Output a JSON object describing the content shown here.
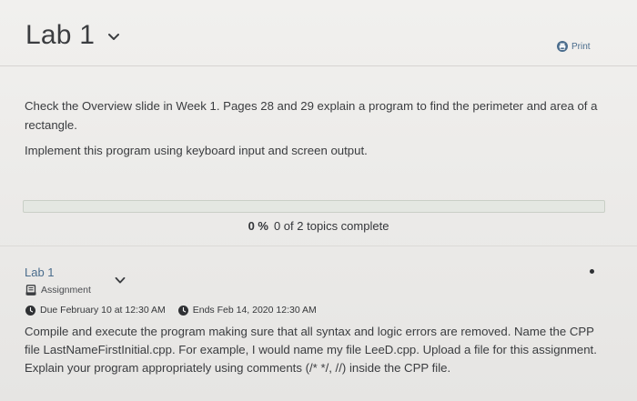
{
  "header": {
    "title": "Lab 1",
    "print_label": "Print"
  },
  "description": {
    "paragraph1": "Check the Overview slide in Week 1. Pages 28 and 29 explain a program to find the perimeter and area of a rectangle.",
    "paragraph2": "Implement this program using keyboard input and screen output."
  },
  "progress": {
    "fraction": 0,
    "percent_label": "0 %",
    "summary": "0 of 2 topics complete"
  },
  "topic": {
    "title": "Lab 1",
    "type_label": "Assignment",
    "due_label": "Due February 10 at 12:30 AM",
    "ends_label": "Ends Feb 14, 2020 12:30 AM",
    "body": "Compile and execute the program making sure that all syntax and logic errors are removed. Name the CPP file LastNameFirstInitial.cpp. For example, I would name my file LeeD.cpp. Upload a file for this assignment. Explain your program appropriately using comments (/* */, //) inside the CPP file."
  },
  "icons": {
    "title_menu": "chevron-down-icon",
    "print": "printer-icon",
    "assignment": "assignment-icon",
    "due": "clock-icon",
    "ends": "clock-icon",
    "topic_menu": "chevron-down-icon"
  },
  "colors": {
    "link": "#4a6c8c",
    "text": "#3a3c3f",
    "background": "#ecebe9",
    "progress_fill": "#6a9a58"
  }
}
